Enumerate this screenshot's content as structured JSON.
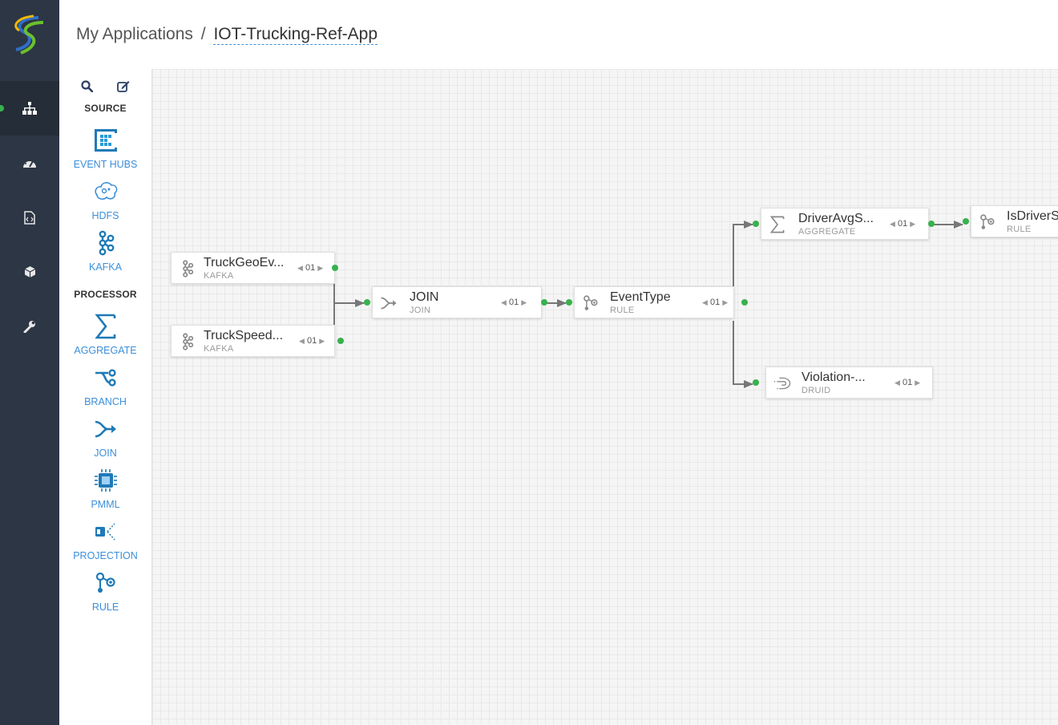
{
  "header": {
    "breadcrumb_root": "My Applications",
    "breadcrumb_separator": "/",
    "app_name": "IOT-Trucking-Ref-App"
  },
  "nav": {
    "items": [
      {
        "icon": "sitemap-icon",
        "active": true
      },
      {
        "icon": "dashboard-icon",
        "active": false
      },
      {
        "icon": "code-file-icon",
        "active": false
      },
      {
        "icon": "cube-icon",
        "active": false
      },
      {
        "icon": "wrench-icon",
        "active": false
      }
    ]
  },
  "palette": {
    "tools": [
      "search-icon",
      "edit-icon"
    ],
    "source_heading": "SOURCE",
    "sources": [
      {
        "label": "EVENT HUBS",
        "icon": "event-hubs-icon"
      },
      {
        "label": "HDFS",
        "icon": "hdfs-icon"
      },
      {
        "label": "KAFKA",
        "icon": "kafka-icon"
      }
    ],
    "processor_heading": "PROCESSOR",
    "processors": [
      {
        "label": "AGGREGATE",
        "icon": "sigma-icon"
      },
      {
        "label": "BRANCH",
        "icon": "branch-icon"
      },
      {
        "label": "JOIN",
        "icon": "join-icon"
      },
      {
        "label": "PMML",
        "icon": "chip-icon"
      },
      {
        "label": "PROJECTION",
        "icon": "projection-icon"
      },
      {
        "label": "RULE",
        "icon": "rule-icon"
      }
    ]
  },
  "graph": {
    "nodes": [
      {
        "id": "truckgeo",
        "title": "TruckGeoEv...",
        "type": "KAFKA",
        "parallelism": "01",
        "icon": "kafka-icon"
      },
      {
        "id": "truckspeed",
        "title": "TruckSpeed...",
        "type": "KAFKA",
        "parallelism": "01",
        "icon": "kafka-icon"
      },
      {
        "id": "join",
        "title": "JOIN",
        "type": "JOIN",
        "parallelism": "01",
        "icon": "join-icon"
      },
      {
        "id": "eventtype",
        "title": "EventType",
        "type": "RULE",
        "parallelism": "01",
        "icon": "rule-icon"
      },
      {
        "id": "driveravg",
        "title": "DriverAvgS...",
        "type": "AGGREGATE",
        "parallelism": "01",
        "icon": "sigma-icon"
      },
      {
        "id": "isdriver",
        "title": "IsDriverS",
        "type": "RULE",
        "icon": "rule-icon"
      },
      {
        "id": "violation",
        "title": "Violation-...",
        "type": "DRUID",
        "parallelism": "01",
        "icon": "druid-icon"
      }
    ]
  },
  "colors": {
    "rail": "#2c3644",
    "accent": "#3b8fd9",
    "port": "#37b24d",
    "edge": "#777777"
  }
}
